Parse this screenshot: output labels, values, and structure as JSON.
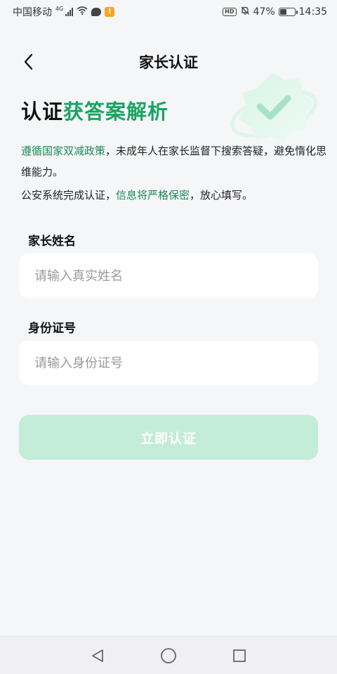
{
  "status_bar": {
    "carrier": "中国移动",
    "network": "4G",
    "battery_percent": "47%",
    "battery_level": 0.47,
    "time": "14:35",
    "hd_label": "HD",
    "app_badge": "!"
  },
  "header": {
    "title": "家长认证"
  },
  "hero": {
    "title_plain": "认证",
    "title_accent": "获答案解析",
    "accent_color": "#1aa463"
  },
  "description": {
    "line1_link": "遵循国家双减政策",
    "line1_rest": "，未成年人在家长监督下搜索答疑，避免惰化思维能力。",
    "line2_start": "公安系统完成认证，",
    "line2_link": "信息将严格保密",
    "line2_end": "，放心填写。"
  },
  "form": {
    "name_label": "家长姓名",
    "name_placeholder": "请输入真实姓名",
    "name_value": "",
    "id_label": "身份证号",
    "id_placeholder": "请输入身份证号",
    "id_value": ""
  },
  "submit": {
    "label": "立即认证",
    "color": "#c3ecd9"
  },
  "nav_bar": {
    "icons": [
      "back-triangle-icon",
      "home-circle-icon",
      "recents-square-icon"
    ]
  }
}
